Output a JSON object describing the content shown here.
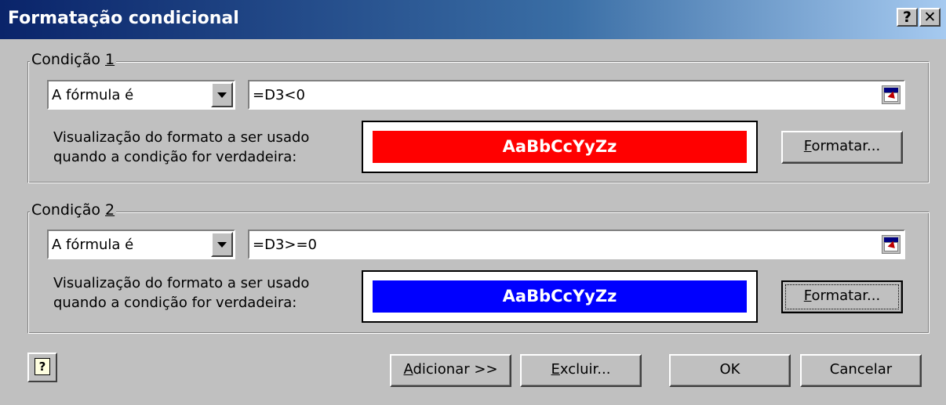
{
  "window": {
    "title": "Formatação condicional",
    "help_glyph": "?",
    "close_glyph": "✕"
  },
  "conditions": [
    {
      "legend_prefix": "Condição ",
      "legend_num": "1",
      "operator": "A fórmula é",
      "formula": "=D3<0",
      "viz_line1": "Visualização do formato a ser usado",
      "viz_line2": "quando a condição for verdadeira:",
      "preview_text": "AaBbCcYyZz",
      "preview_color": "#ff0000",
      "format_btn_first": "F",
      "format_btn_rest": "ormatar..."
    },
    {
      "legend_prefix": "Condição ",
      "legend_num": "2",
      "operator": "A fórmula é",
      "formula": "=D3>=0",
      "viz_line1": "Visualização do formato a ser usado",
      "viz_line2": "quando a condição for verdadeira:",
      "preview_text": "AaBbCcYyZz",
      "preview_color": "#0000ff",
      "format_btn_first": "F",
      "format_btn_rest": "ormatar..."
    }
  ],
  "footer": {
    "help_glyph": "?",
    "add_first": "A",
    "add_rest": "dicionar >>",
    "delete_first": "E",
    "delete_rest": "xcluir...",
    "ok": "OK",
    "cancel": "Cancelar"
  }
}
